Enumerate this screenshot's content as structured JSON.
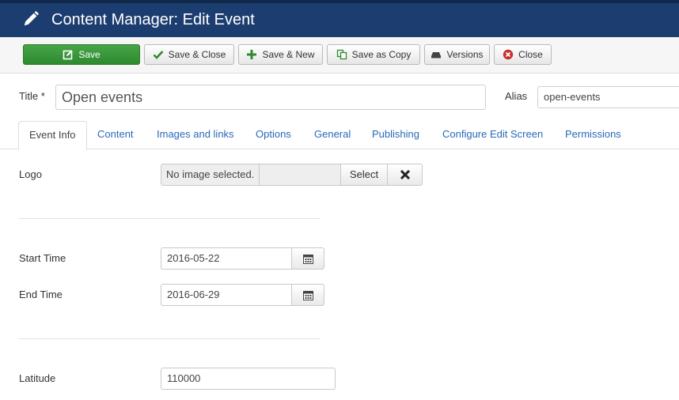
{
  "header": {
    "title": "Content Manager: Edit Event",
    "icon": "pencil-icon"
  },
  "toolbar": {
    "save": "Save",
    "save_close": "Save & Close",
    "save_new": "Save & New",
    "save_copy": "Save as Copy",
    "versions": "Versions",
    "close": "Close"
  },
  "form": {
    "title_label": "Title *",
    "title_value": "Open events",
    "alias_label": "Alias",
    "alias_value": "open-events"
  },
  "tabs": [
    {
      "label": "Event Info",
      "active": true
    },
    {
      "label": "Content"
    },
    {
      "label": "Images and links"
    },
    {
      "label": "Options"
    },
    {
      "label": "General"
    },
    {
      "label": "Publishing"
    },
    {
      "label": "Configure Edit Screen"
    },
    {
      "label": "Permissions"
    }
  ],
  "fields": {
    "logo_label": "Logo",
    "logo_value": "No image selected.",
    "logo_select": "Select",
    "start_label": "Start Time",
    "start_value": "2016-05-22",
    "end_label": "End Time",
    "end_value": "2016-06-29",
    "latitude_label": "Latitude",
    "latitude_value": "110000"
  },
  "colors": {
    "header": "#1c3d70",
    "save_button": "#3a983a",
    "link": "#2a69b8"
  }
}
